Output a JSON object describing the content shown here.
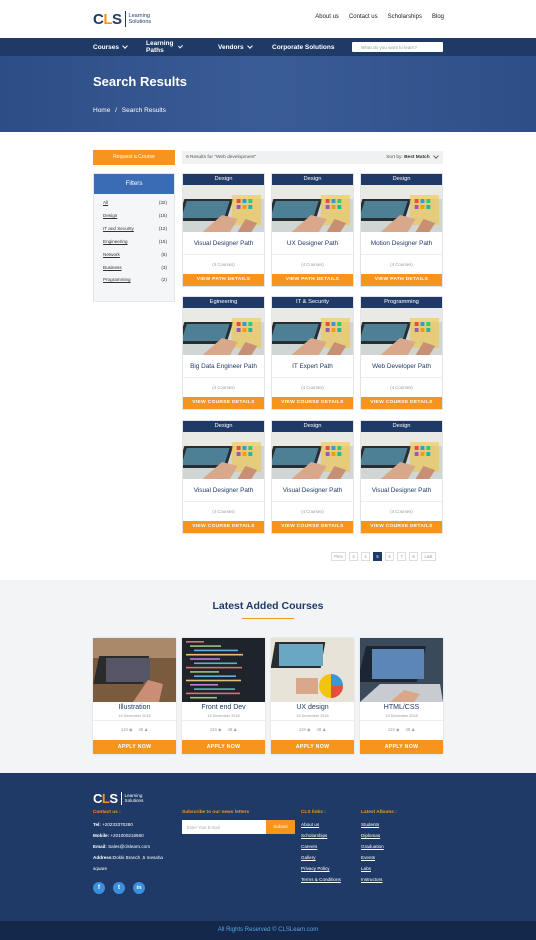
{
  "header": {
    "logo_mark": "CLS",
    "logo_text_1": "Learning",
    "logo_text_2": "Solutions",
    "links": [
      "About us",
      "Contact us",
      "Scholarships",
      "Blog"
    ]
  },
  "nav": {
    "items": [
      {
        "label": "Courses",
        "dropdown": true
      },
      {
        "label": "Learning Paths",
        "dropdown": true
      },
      {
        "label": "Vendors",
        "dropdown": true
      },
      {
        "label": "Corporate Solutions",
        "dropdown": false
      }
    ],
    "search_placeholder": "What do you want to learn?"
  },
  "hero": {
    "title": "Search Results",
    "breadcrumb_home": "Home",
    "breadcrumb_sep": "/",
    "breadcrumb_current": "Search Results"
  },
  "sidebar": {
    "request_label": "Request a Course",
    "filters_title": "Filters",
    "filters": [
      {
        "name": "All",
        "count": "(32)"
      },
      {
        "name": "Design",
        "count": "(15)"
      },
      {
        "name": "IT and Security",
        "count": "(12)"
      },
      {
        "name": "Engineering",
        "count": "(15)"
      },
      {
        "name": "Network",
        "count": "(5)"
      },
      {
        "name": "Business",
        "count": "(3)"
      },
      {
        "name": "Programming",
        "count": "(2)"
      }
    ]
  },
  "results": {
    "summary": "9 Results for \"Web development\"",
    "sort_label": "Sort by:",
    "sort_value": "Best Match",
    "cards": [
      {
        "category": "Design",
        "title": "Visual Designer Path",
        "sub": "(4 Courses)",
        "button": "VIEW PATH DETAILS"
      },
      {
        "category": "Design",
        "title": "UX Designer Path",
        "sub": "(4 Courses)",
        "button": "VIEW PATH DETAILS"
      },
      {
        "category": "Design",
        "title": "Motion Designer Path",
        "sub": "(4 Courses)",
        "button": "VIEW PATH DETAILS"
      },
      {
        "category": "Egineering",
        "title": "Big Data Engineer Path",
        "sub": "(4 Courses)",
        "button": "VIEW COURSE DETAILS"
      },
      {
        "category": "IT & Security",
        "title": "IT Expert Path",
        "sub": "(4 Courses)",
        "button": "VIEW COURSE DETAILS"
      },
      {
        "category": "Programming",
        "title": "Web Developer Path",
        "sub": "(4 Courses)",
        "button": "VIEW COURSE DETAILS"
      },
      {
        "category": "Design",
        "title": "Visual Designer Path",
        "sub": "(4 Courses)",
        "button": "VIEW COURSE DETAILS"
      },
      {
        "category": "Design",
        "title": "Visual Designer Path",
        "sub": "(4 Courses)",
        "button": "VIEW COURSE DETAILS"
      },
      {
        "category": "Design",
        "title": "Visual Designer Path",
        "sub": "(4 Courses)",
        "button": "VIEW COURSE DETAILS"
      }
    ]
  },
  "pagination": {
    "prev": "Prev",
    "pages": [
      "3",
      "4",
      "5",
      "6",
      "7",
      "8"
    ],
    "active": "5",
    "next": "Last"
  },
  "latest": {
    "heading": "Latest Added Courses",
    "courses": [
      {
        "title": "Illustration",
        "date": "19 December 2018",
        "views": "124",
        "users": "48",
        "button": "APPLY NOW"
      },
      {
        "title": "Front end Dev",
        "date": "19 December 2018",
        "views": "124",
        "users": "48",
        "button": "APPLY NOW"
      },
      {
        "title": "UX design",
        "date": "19 December 2018",
        "views": "124",
        "users": "48",
        "button": "APPLY NOW"
      },
      {
        "title": "HTML/CSS",
        "date": "19 December 2018",
        "views": "124",
        "users": "48",
        "button": "APPLY NOW"
      }
    ]
  },
  "footer": {
    "contact_heading": "Contact us :",
    "tel_label": "Tel:",
    "tel": "+20233370280",
    "mobile_label": "Mobile:",
    "mobile": "+201000216660",
    "email_label": "Email:",
    "email": "Sales@clslearn.com",
    "address_label": "Address:",
    "address_1": "Dokki Branch ,5 mesaha",
    "address_2": "square",
    "newsletter_heading": "Subscribe to our news letters",
    "email_placeholder": "Enter Your E-mail",
    "subscribe_label": "Submit",
    "links_heading": "CLS links :",
    "links": [
      "About us",
      "Scholarships",
      "Careers",
      "Gallery",
      "Privacy Policy",
      "Terms & Conditions"
    ],
    "albums_heading": "Latest Albums :",
    "albums": [
      "Students",
      "Diplomas",
      "Graduation",
      "Events",
      "Labs",
      "Instructors"
    ],
    "social": [
      "f",
      "t",
      "in"
    ],
    "copyright": "All Rights Reserved © CLSLearn.com"
  }
}
